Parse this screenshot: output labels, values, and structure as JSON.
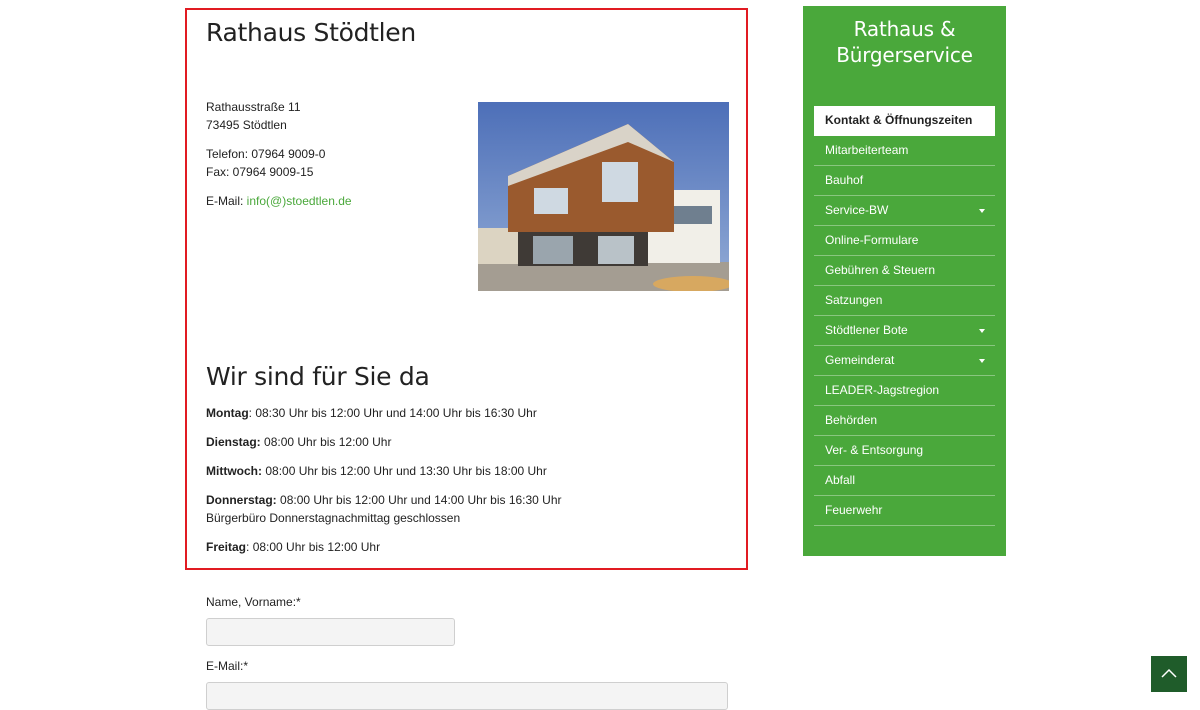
{
  "main": {
    "title": "Rathaus Stödtlen",
    "address_line1": "Rathausstraße 11",
    "address_line2": "73495 Stödtlen",
    "phone": "Telefon: 07964 9009-0",
    "fax": "Fax: 07964 9009-15",
    "email_label": "E-Mail: ",
    "email_link": "info(@)stoedtlen.de",
    "photo_icon": "building-photo",
    "hours_title": "Wir sind für Sie da",
    "hours": [
      {
        "day": "Montag",
        "sep": ": ",
        "text": "08:30 Uhr bis 12:00 Uhr und 14:00 Uhr bis 16:30 Uhr"
      },
      {
        "day": "Dienstag:",
        "sep": " ",
        "text": "08:00 Uhr bis 12:00 Uhr"
      },
      {
        "day": "Mittwoch:",
        "sep": " ",
        "text": "08:00 Uhr bis 12:00 Uhr und 13:30 Uhr bis 18:00 Uhr"
      },
      {
        "day": "Donnerstag:",
        "sep": " ",
        "text": "08:00 Uhr bis 12:00 Uhr und 14:00 Uhr bis 16:30 Uhr",
        "note": "Bürgerbüro Donnerstagnachmittag geschlossen"
      },
      {
        "day": "Freitag",
        "sep": ": ",
        "text": "08:00 Uhr bis 12:00 Uhr"
      }
    ]
  },
  "form": {
    "name_label": "Name, Vorname:*",
    "name_value": "",
    "email_label": "E-Mail:*",
    "email_value": ""
  },
  "sidebar": {
    "title_line1": "Rathaus &",
    "title_line2": "Bürgerservice",
    "items": [
      {
        "label": "Kontakt & Öffnungszeiten",
        "active": true
      },
      {
        "label": "Mitarbeiterteam"
      },
      {
        "label": "Bauhof"
      },
      {
        "label": "Service-BW",
        "dropdown": true
      },
      {
        "label": "Online-Formulare"
      },
      {
        "label": "Gebühren & Steuern"
      },
      {
        "label": "Satzungen"
      },
      {
        "label": "Stödtlener Bote",
        "dropdown": true
      },
      {
        "label": "Gemeinderat",
        "dropdown": true
      },
      {
        "label": "LEADER-Jagstregion"
      },
      {
        "label": "Behörden"
      },
      {
        "label": "Ver- & Entsorgung"
      },
      {
        "label": "Abfall"
      },
      {
        "label": "Feuerwehr"
      }
    ]
  },
  "scroll_top_icon": "chevron-up-icon",
  "colors": {
    "accent": "#4aa83b",
    "highlight_border": "#e11b22",
    "scroll_button": "#1f5c2a"
  }
}
